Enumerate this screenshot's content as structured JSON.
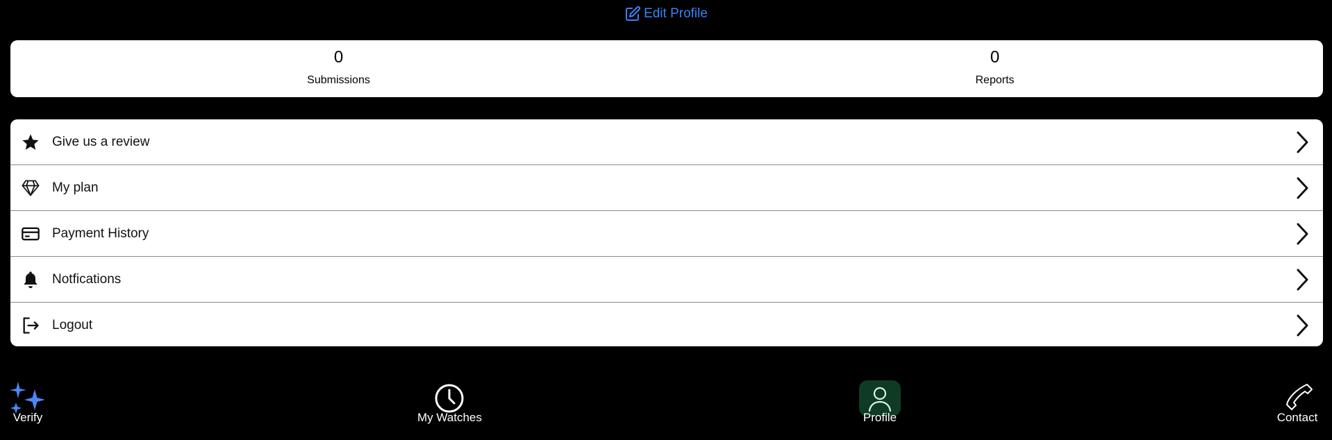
{
  "header": {
    "edit_profile_label": "Edit Profile",
    "edit_icon": "edit-icon",
    "accent_color": "#3b82f6"
  },
  "stats": [
    {
      "value": "0",
      "label": "Submissions"
    },
    {
      "value": "0",
      "label": "Reports"
    }
  ],
  "menu": {
    "items": [
      {
        "label": "Give us a review",
        "icon": "star-icon"
      },
      {
        "label": "My plan",
        "icon": "diamond-icon"
      },
      {
        "label": "Payment History",
        "icon": "credit-card-icon"
      },
      {
        "label": "Notfications",
        "icon": "bell-icon"
      },
      {
        "label": "Logout",
        "icon": "logout-icon"
      }
    ]
  },
  "bottom_nav": {
    "items": [
      {
        "label": "Verify",
        "icon": "sparkles-icon"
      },
      {
        "label": "My Watches",
        "icon": "clock-icon"
      },
      {
        "label": "Profile",
        "icon": "user-icon",
        "active": true
      },
      {
        "label": "Contact",
        "icon": "phone-icon"
      }
    ],
    "active_bg_color": "#0f3b24"
  }
}
